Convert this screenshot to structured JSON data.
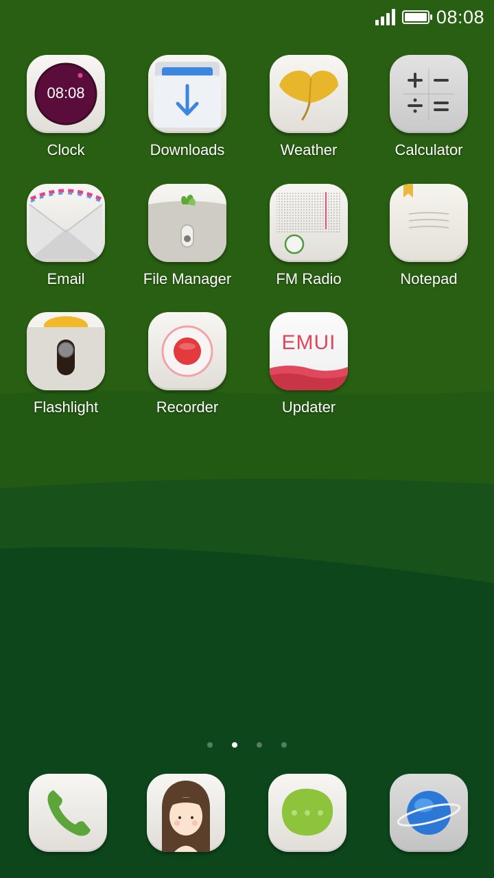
{
  "status_bar": {
    "time": "08:08"
  },
  "apps": [
    {
      "label": "Clock",
      "icon": "clock-icon",
      "face_time": "08:08"
    },
    {
      "label": "Downloads",
      "icon": "download-arrow-icon"
    },
    {
      "label": "Weather",
      "icon": "ginkgo-leaf-icon"
    },
    {
      "label": "Calculator",
      "icon": "calculator-icon"
    },
    {
      "label": "Email",
      "icon": "envelope-icon"
    },
    {
      "label": "File Manager",
      "icon": "folder-icon"
    },
    {
      "label": "FM Radio",
      "icon": "radio-icon"
    },
    {
      "label": "Notepad",
      "icon": "notepad-icon"
    },
    {
      "label": "Flashlight",
      "icon": "flashlight-switch-icon"
    },
    {
      "label": "Recorder",
      "icon": "record-icon"
    },
    {
      "label": "Updater",
      "icon": "emui-updater-icon",
      "badge_text": "EMUI"
    }
  ],
  "page_indicator": {
    "count": 4,
    "active_index": 1
  },
  "dock": [
    {
      "icon": "phone-icon"
    },
    {
      "icon": "contacts-girl-icon"
    },
    {
      "icon": "messaging-icon"
    },
    {
      "icon": "browser-planet-icon"
    }
  ],
  "colors": {
    "wallpaper_top": "#275e12",
    "wallpaper_mid": "#1a5113",
    "wallpaper_bottom": "#0b4419",
    "accent_red": "#e0455b"
  }
}
